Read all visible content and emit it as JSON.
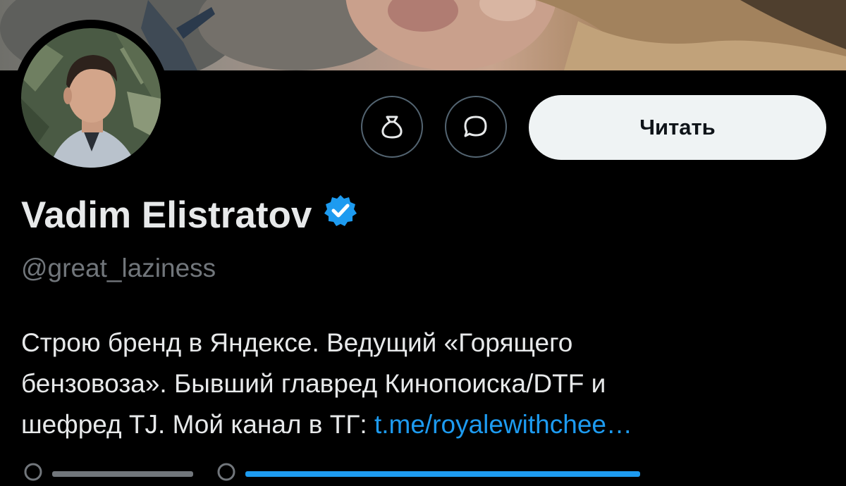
{
  "header": {
    "banner_alt": "profile banner photo",
    "avatar_alt": "profile avatar photo"
  },
  "actions": {
    "tip_icon": "money-bag-icon",
    "message_icon": "message-bubble-icon",
    "follow_label": "Читать"
  },
  "profile": {
    "display_name": "Vadim Elistratov",
    "verified_icon": "verified-badge-icon",
    "verified_color": "#1d9bf0",
    "handle": "@great_laziness",
    "bio_line_1": "Строю бренд в Яндексе. Ведущий «Горящего",
    "bio_line_2": "бензовоза». Бывший главред Кинопоиска/DTF и",
    "bio_line_3_text": "шефред TJ. Мой канал в ТГ: ",
    "bio_line_3_link": "t.me/royalewithchee…"
  },
  "colors": {
    "background": "#000000",
    "text_primary": "#e7e9ea",
    "text_secondary": "#71767b",
    "link": "#1d9bf0",
    "button_bg": "#eff3f4",
    "button_text": "#0f1419",
    "outline": "#536471"
  }
}
